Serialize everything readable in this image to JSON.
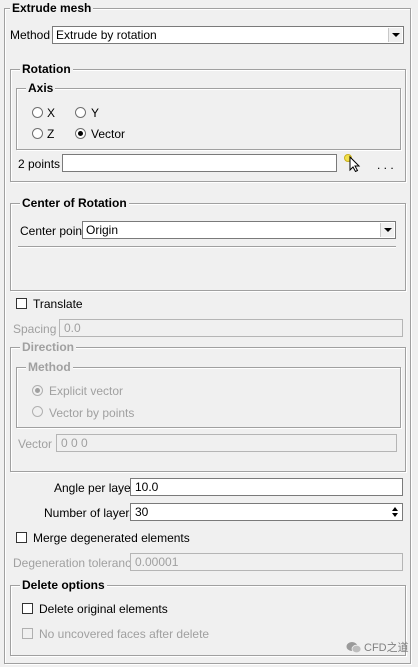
{
  "panel": {
    "title": "Extrude mesh"
  },
  "method": {
    "label": "Method",
    "value": "Extrude by rotation"
  },
  "rotation": {
    "title": "Rotation",
    "axis": {
      "title": "Axis",
      "options": [
        "X",
        "Y",
        "Z",
        "Vector"
      ],
      "selected": "Vector"
    },
    "two_points": {
      "label": "2 points",
      "value": ""
    },
    "pick_icon": "cursor-pick-icon",
    "more_label": ". . ."
  },
  "center": {
    "title": "Center of Rotation",
    "label": "Center point",
    "value": "Origin"
  },
  "translate": {
    "label": "Translate",
    "checked": false
  },
  "spacing": {
    "label": "Spacing",
    "value": "0.0"
  },
  "direction": {
    "title": "Direction",
    "method_title": "Method",
    "options": [
      "Explicit vector",
      "Vector by points"
    ],
    "selected": "Explicit vector",
    "vector_label": "Vector",
    "vector_value": "0 0 0"
  },
  "angle": {
    "label": "Angle per layer",
    "value": "10.0"
  },
  "layers": {
    "label": "Number of layers",
    "value": "30"
  },
  "merge": {
    "label": "Merge degenerated elements",
    "checked": false
  },
  "degeneration": {
    "label": "Degeneration tolerance",
    "value": "0.00001"
  },
  "delete_options": {
    "title": "Delete options",
    "delete_original": "Delete original elements",
    "no_uncovered": "No uncovered faces after delete"
  },
  "watermark": "CFD之道",
  "colors": {
    "background": "#f0f0f0",
    "border": "#a0a0a0",
    "disabled_text": "#a0a0a0"
  }
}
